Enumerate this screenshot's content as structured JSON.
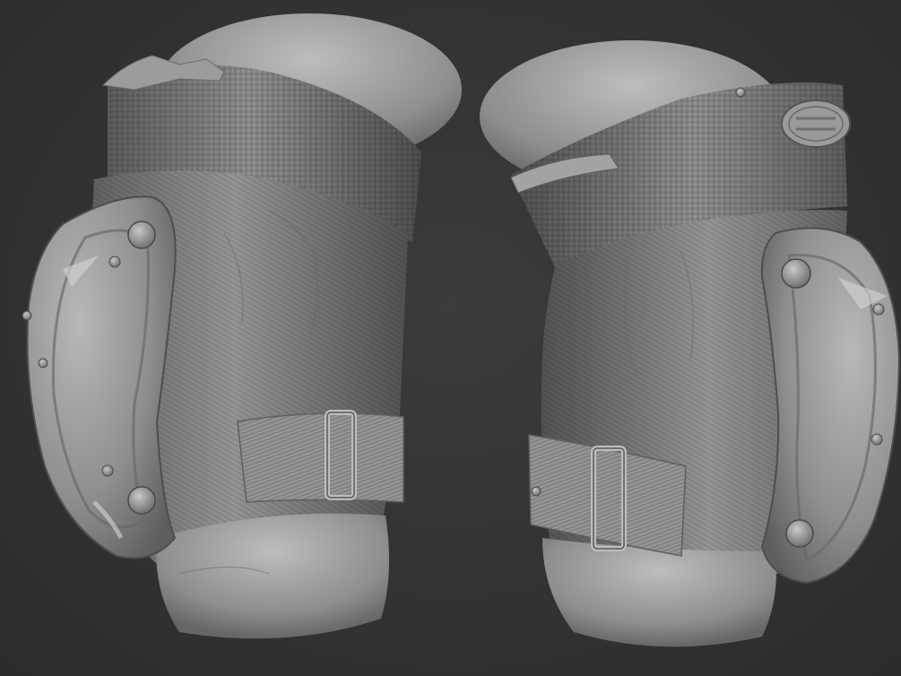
{
  "scene": {
    "background_color": "#353535",
    "material_color": "#8c8c8c",
    "subject": "pair-of-sculpted-elbow-pads",
    "pads": [
      {
        "id": "left",
        "facing": "right",
        "strap_buckle": true,
        "cap_rivets": 6
      },
      {
        "id": "right",
        "facing": "left",
        "strap_buckle": true,
        "cap_rivets": 6,
        "logo_patch": true
      }
    ]
  }
}
